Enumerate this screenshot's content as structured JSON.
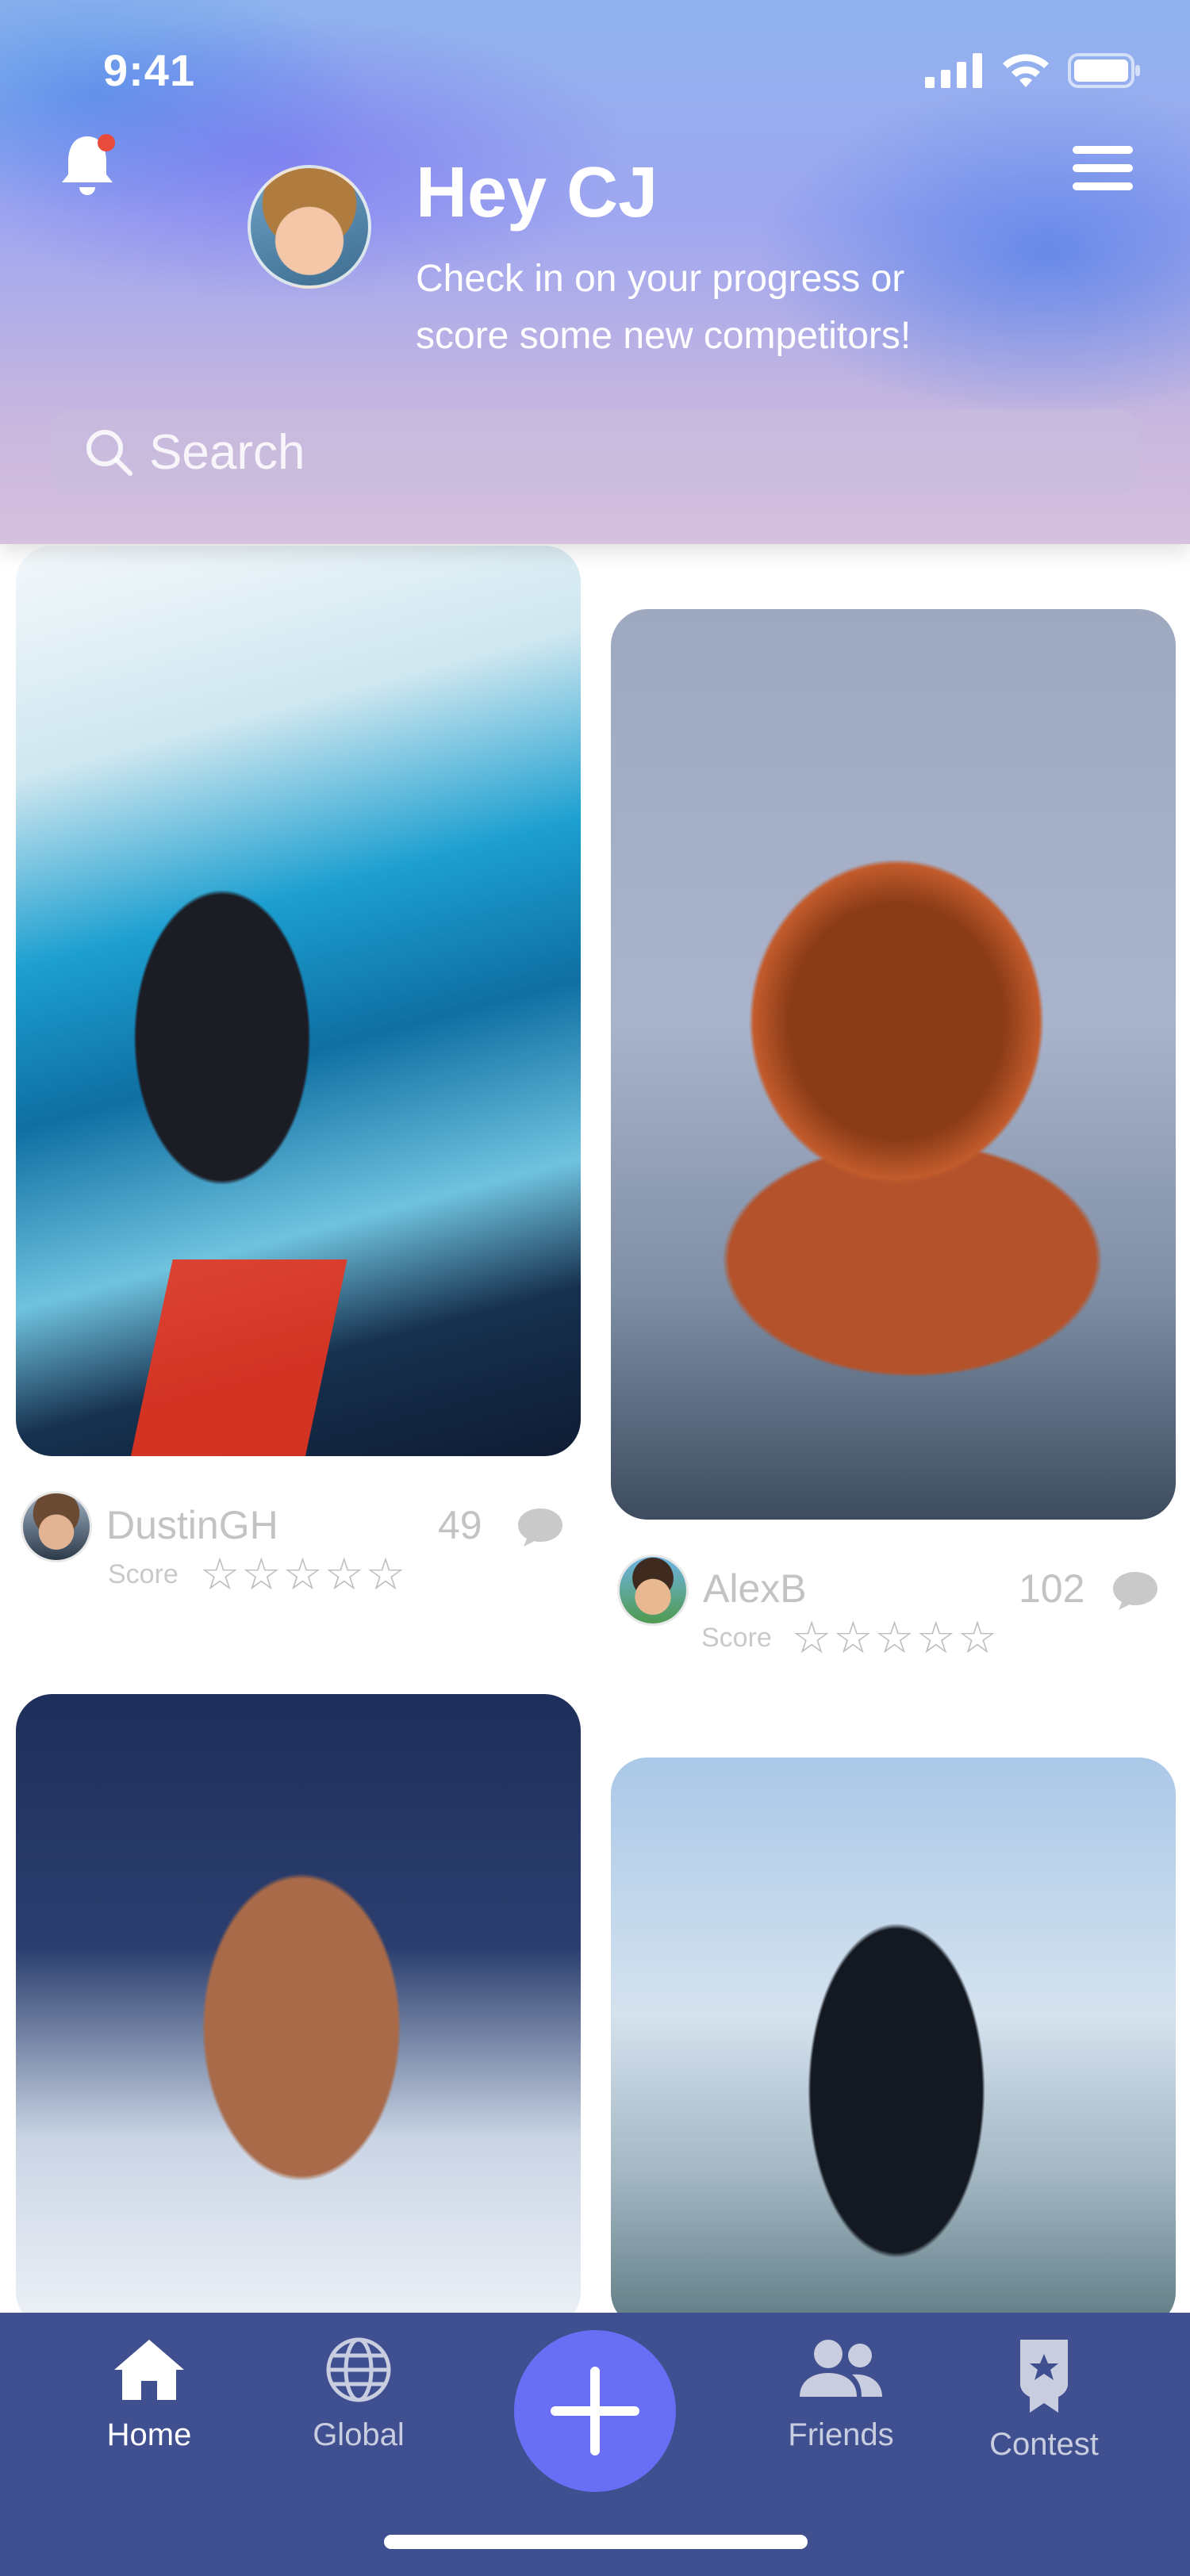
{
  "status_bar": {
    "time": "9:41"
  },
  "header": {
    "greeting": "Hey CJ",
    "subtitle_line1": "Check in on your progress or",
    "subtitle_line2": "score some new competitors!"
  },
  "search": {
    "placeholder": "Search"
  },
  "feed": {
    "posts": [
      {
        "username": "DustinGH",
        "count": "49",
        "score_label": "Score",
        "stars": "☆☆☆☆☆",
        "rating": 0
      },
      {
        "username": "AlexB",
        "count": "102",
        "score_label": "Score",
        "stars": "☆☆☆☆☆",
        "rating": 0
      }
    ]
  },
  "tabbar": {
    "tabs": [
      {
        "label": "Home",
        "icon": "home-icon",
        "active": true
      },
      {
        "label": "Global",
        "icon": "globe-icon",
        "active": false
      },
      {
        "label": "Friends",
        "icon": "friends-icon",
        "active": false
      },
      {
        "label": "Contest",
        "icon": "award-icon",
        "active": false
      }
    ],
    "fab_icon": "plus-icon"
  },
  "colors": {
    "tabbar_bg": "#3f4f8f",
    "fab_bg": "#6a6ef5",
    "notification_dot": "#e84b3c"
  }
}
